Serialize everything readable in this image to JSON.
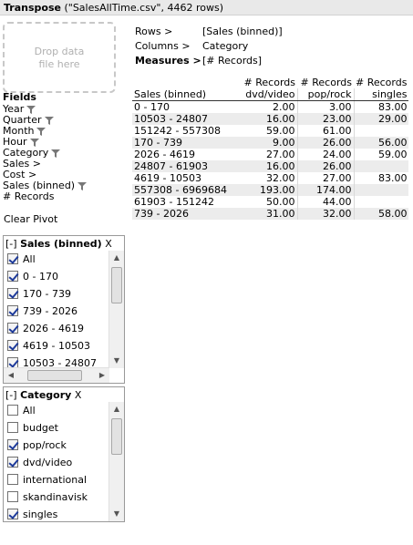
{
  "title": {
    "bold": "Transpose",
    "rest": " (\"SalesAllTime.csv\", 4462 rows)"
  },
  "dropzone": {
    "line1": "Drop data",
    "line2": "file here"
  },
  "fields": {
    "header": "Fields",
    "items": [
      {
        "label": "Year",
        "filter": true
      },
      {
        "label": "Quarter",
        "filter": true
      },
      {
        "label": "Month",
        "filter": true
      },
      {
        "label": "Hour",
        "filter": true
      },
      {
        "label": "Category",
        "filter": true
      },
      {
        "label": "Sales >",
        "filter": false
      },
      {
        "label": "Cost >",
        "filter": false
      },
      {
        "label": "Sales (binned)",
        "filter": true
      },
      {
        "label": "# Records",
        "filter": false
      }
    ]
  },
  "clear_pivot": "Clear Pivot",
  "config": {
    "rows_label": "Rows >",
    "rows_value": "[Sales (binned)]",
    "columns_label": "Columns >",
    "columns_value": "Category",
    "measures_label": "Measures >",
    "measures_value": "[# Records]"
  },
  "table": {
    "row_header": "Sales (binned)",
    "measure": "# Records",
    "columns": [
      "dvd/video",
      "pop/rock",
      "singles"
    ],
    "rows": [
      {
        "label": "0 - 170",
        "values": [
          "2.00",
          "3.00",
          "83.00"
        ]
      },
      {
        "label": "10503 - 24807",
        "values": [
          "16.00",
          "23.00",
          "29.00"
        ]
      },
      {
        "label": "151242 - 557308",
        "values": [
          "59.00",
          "61.00",
          ""
        ]
      },
      {
        "label": "170 - 739",
        "values": [
          "9.00",
          "26.00",
          "56.00"
        ]
      },
      {
        "label": "2026 - 4619",
        "values": [
          "27.00",
          "24.00",
          "59.00"
        ]
      },
      {
        "label": "24807 - 61903",
        "values": [
          "16.00",
          "26.00",
          ""
        ]
      },
      {
        "label": "4619 - 10503",
        "values": [
          "32.00",
          "27.00",
          "83.00"
        ]
      },
      {
        "label": "557308 - 6969684",
        "values": [
          "193.00",
          "174.00",
          ""
        ]
      },
      {
        "label": "61903 - 151242",
        "values": [
          "50.00",
          "44.00",
          ""
        ]
      },
      {
        "label": "739 - 2026",
        "values": [
          "31.00",
          "32.00",
          "58.00"
        ]
      }
    ]
  },
  "sales_filter": {
    "collapse": "[-]",
    "title": "Sales (binned)",
    "close": "X",
    "items": [
      {
        "label": "All",
        "checked": true
      },
      {
        "label": "0 - 170",
        "checked": true
      },
      {
        "label": "170 - 739",
        "checked": true
      },
      {
        "label": "739 - 2026",
        "checked": true
      },
      {
        "label": "2026 - 4619",
        "checked": true
      },
      {
        "label": "4619 - 10503",
        "checked": true
      },
      {
        "label": "10503 - 24807",
        "checked": true
      }
    ]
  },
  "category_filter": {
    "collapse": "[-]",
    "title": "Category",
    "close": "X",
    "items": [
      {
        "label": "All",
        "checked": false
      },
      {
        "label": "budget",
        "checked": false
      },
      {
        "label": "pop/rock",
        "checked": true
      },
      {
        "label": "dvd/video",
        "checked": true
      },
      {
        "label": "international",
        "checked": false
      },
      {
        "label": "skandinavisk",
        "checked": false
      },
      {
        "label": "singles",
        "checked": true
      }
    ]
  }
}
